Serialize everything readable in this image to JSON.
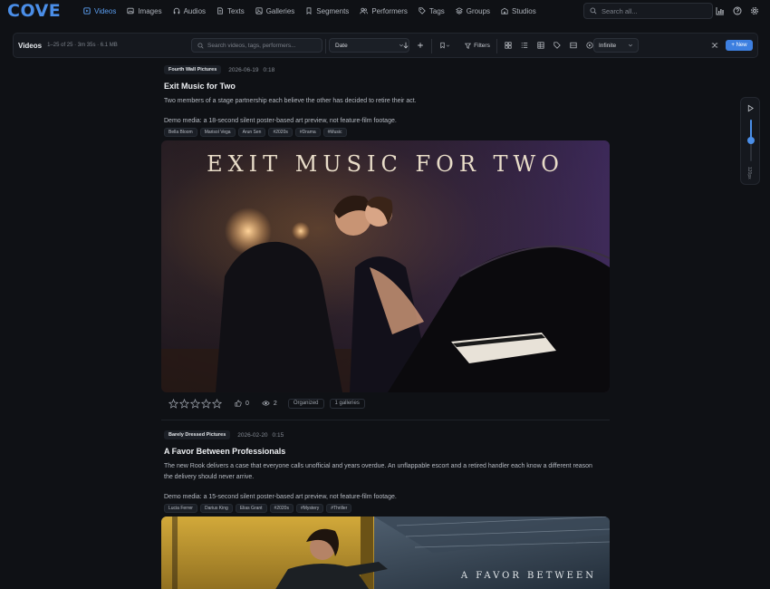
{
  "app": {
    "logo": "COVE",
    "nav": [
      {
        "label": "Videos",
        "icon": "video-icon",
        "active": true
      },
      {
        "label": "Images",
        "icon": "image-icon",
        "active": false
      },
      {
        "label": "Audios",
        "icon": "headphones-icon",
        "active": false
      },
      {
        "label": "Texts",
        "icon": "document-icon",
        "active": false
      },
      {
        "label": "Galleries",
        "icon": "gallery-icon",
        "active": false
      },
      {
        "label": "Segments",
        "icon": "bookmark-icon",
        "active": false
      },
      {
        "label": "Performers",
        "icon": "users-icon",
        "active": false
      },
      {
        "label": "Tags",
        "icon": "tag-icon",
        "active": false
      },
      {
        "label": "Groups",
        "icon": "layers-icon",
        "active": false
      },
      {
        "label": "Studios",
        "icon": "building-icon",
        "active": false
      }
    ],
    "search_placeholder": "Search all...",
    "accent": "#4a8ee8"
  },
  "toolbar": {
    "title": "Videos",
    "meta": "1–25 of 25 · 3m 35s · 6.1 MB",
    "search_placeholder": "Search videos, tags, performers...",
    "sort_value": "Date",
    "filters_label": "Filters",
    "paging_value": "Infinite",
    "new_label": "+ New"
  },
  "cards": [
    {
      "studio": "Fourth Wall Pictures",
      "date": "2026-06-19",
      "duration": "0:18",
      "title": "Exit Music for Two",
      "description": "Two members of a stage partnership each believe the other has decided to retire their act.",
      "demo": "Demo media: a 18-second silent poster-based art preview, not feature-film footage.",
      "chips": [
        "Bella Bloom",
        "Marisol Vega",
        "Arun Sen",
        "#2020s",
        "#Drama",
        "#Music"
      ],
      "poster_title": "EXIT MUSIC FOR TWO",
      "likes": "0",
      "views": "2",
      "organized_label": "Organized",
      "galleries_label": "1 galleries"
    },
    {
      "studio": "Barely Dressed Pictures",
      "date": "2026-02-20",
      "duration": "0:15",
      "title": "A Favor Between Professionals",
      "description": "The new Rook delivers a case that everyone calls unofficial and years overdue. An unflappable escort and a retired handler each know a different reason the delivery should never arrive.",
      "demo": "Demo media: a 15-second silent poster-based art preview, not feature-film footage.",
      "chips": [
        "Lucia Ferrer",
        "Darius King",
        "Elias Grant",
        "#2020s",
        "#Mystery",
        "#Thriller"
      ],
      "poster_title": "A FAVOR BETWEEN"
    }
  ],
  "rail": {
    "label": "120px",
    "zoom_level": 0.5
  }
}
